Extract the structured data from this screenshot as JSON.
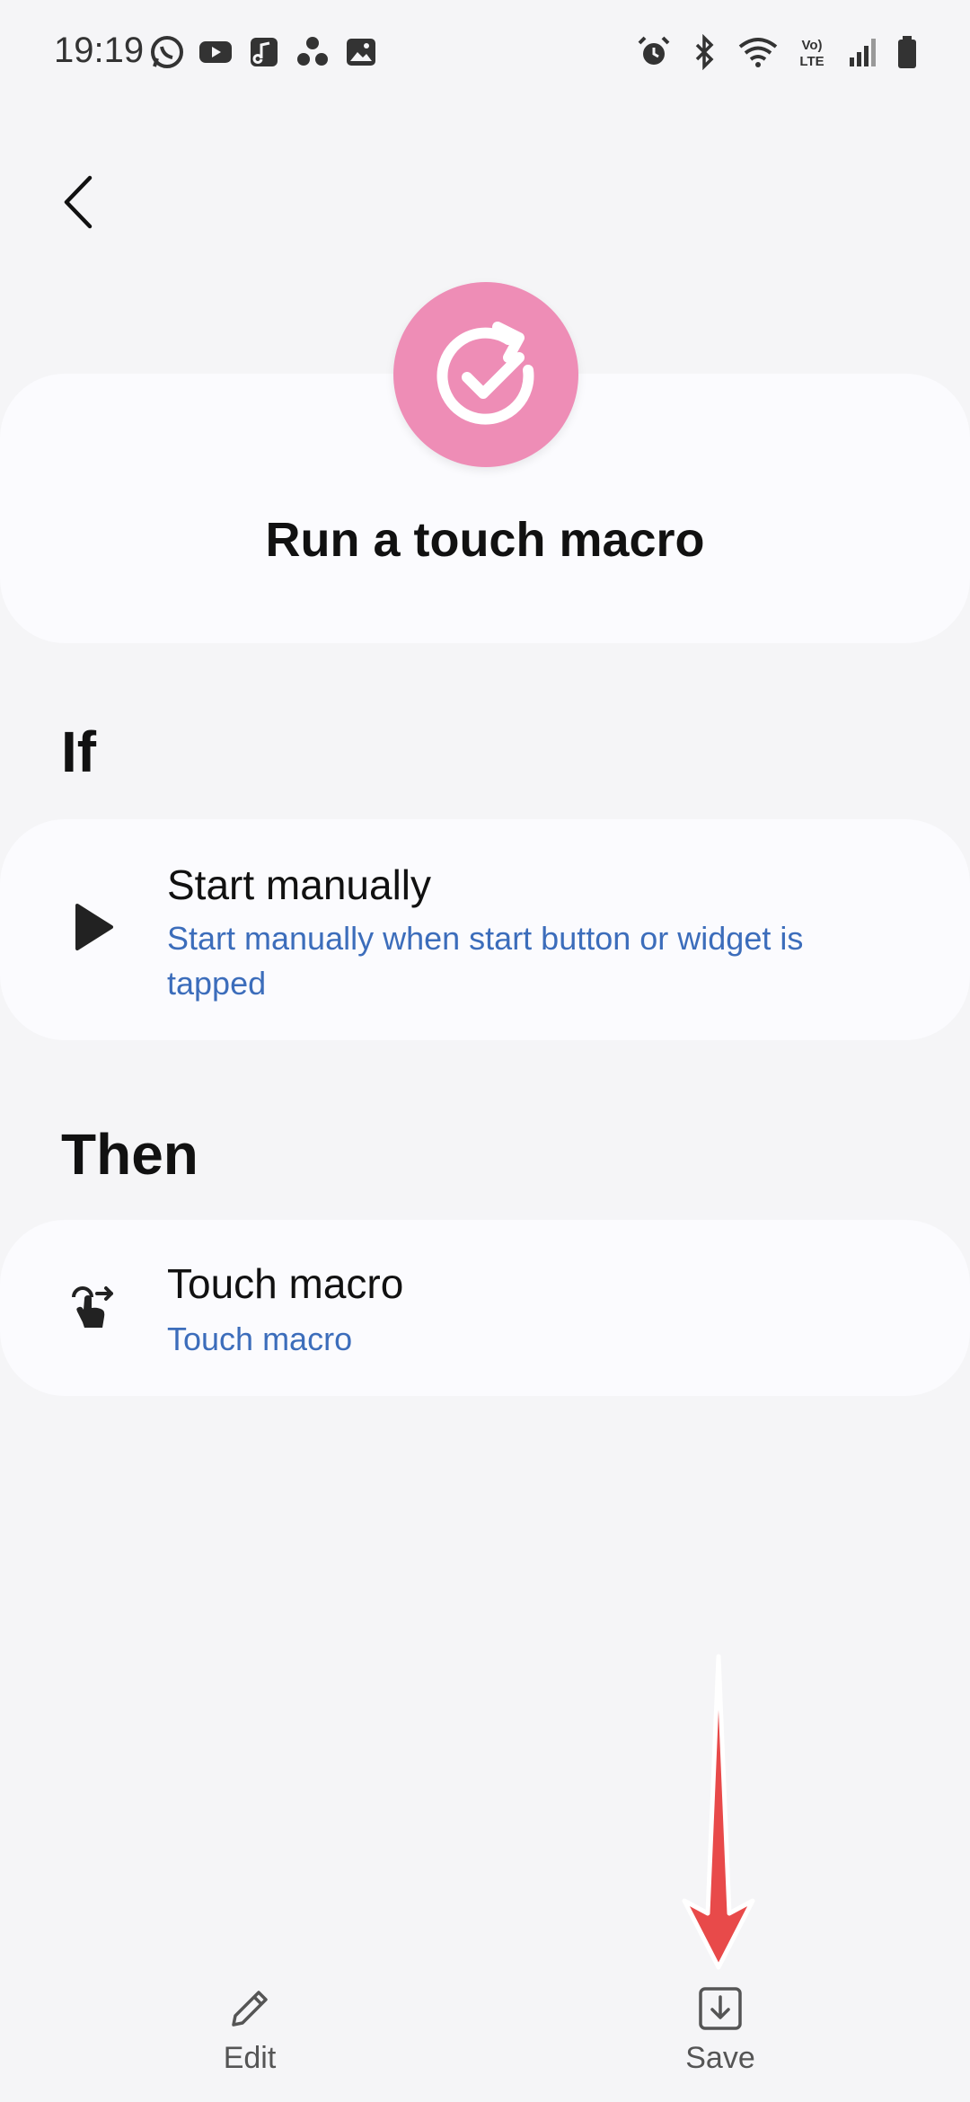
{
  "status_bar": {
    "time": "19:19",
    "left_icons": [
      "whatsapp-icon",
      "youtube-icon",
      "music-icon",
      "bixby-icon",
      "gallery-icon"
    ],
    "right_icons": [
      "alarm-icon",
      "bluetooth-icon",
      "wifi-icon",
      "volte-icon",
      "signal-icon",
      "battery-icon"
    ]
  },
  "header": {
    "back_icon": "chevron-left-icon"
  },
  "routine": {
    "title": "Run a touch macro",
    "icon": "routine-check-icon",
    "icon_color": "#ee8db6"
  },
  "if_section": {
    "heading": "If",
    "condition": {
      "icon": "play-icon",
      "title": "Start manually",
      "subtitle": "Start manually when start button or widget is tapped"
    }
  },
  "then_section": {
    "heading": "Then",
    "action": {
      "icon": "touch-gesture-icon",
      "title": "Touch macro",
      "subtitle": "Touch macro"
    }
  },
  "bottom_bar": {
    "edit_label": "Edit",
    "save_label": "Save"
  },
  "colors": {
    "accent_link": "#3c6dbb",
    "annotation_arrow": "#e84a4a",
    "background": "#f5f5f7",
    "card": "#fbfbfe"
  }
}
